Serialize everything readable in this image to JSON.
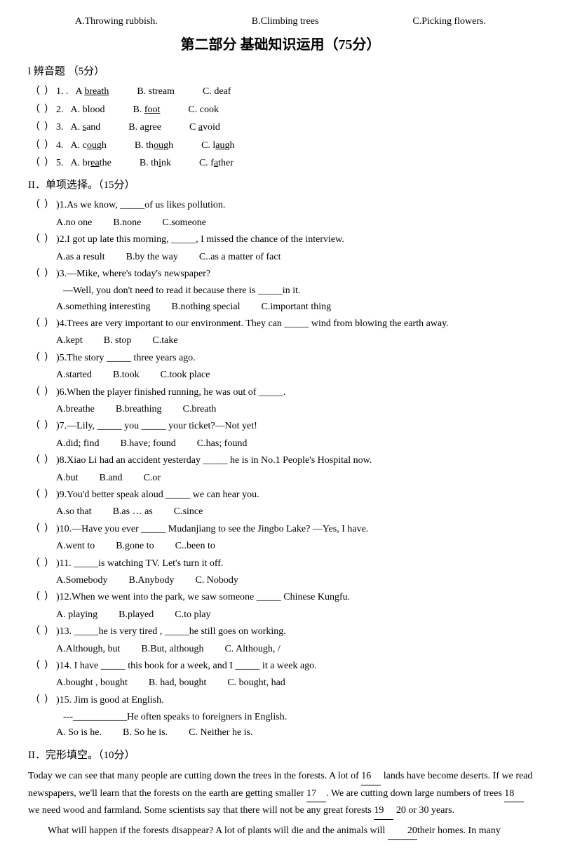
{
  "header": {
    "options": [
      "A.Throwing rubbish.",
      "B.Climbing trees",
      "C.Picking flowers."
    ]
  },
  "part2_title": "第二部分  基础知识运用（75分）",
  "section1": {
    "title": "l 辨音题  （5分）",
    "questions": [
      {
        "num": "1.",
        "label": "A",
        "options": [
          "A. breath",
          "B. stream",
          "C. deaf"
        ]
      },
      {
        "num": "2.",
        "label": "A",
        "options": [
          "A. blood",
          "B. foot",
          "C. cook"
        ]
      },
      {
        "num": "3.",
        "label": "A",
        "options": [
          "A. sand",
          "B. agree",
          "C avoid"
        ]
      },
      {
        "num": "4.",
        "label": "A",
        "options": [
          "A. cough",
          "B. though",
          "C. laugh"
        ]
      },
      {
        "num": "5.",
        "label": "A",
        "options": [
          "A. breathe",
          "B. think",
          "C. father"
        ]
      }
    ]
  },
  "section2": {
    "title": "II．单项选择。（15分）",
    "questions": [
      {
        "num": "1.",
        "text": "As we know, _____of us likes pollution.",
        "options": [
          "A.no one",
          "B.none",
          "C.someone"
        ]
      },
      {
        "num": "2.",
        "text": "I got up late this morning, _____, I missed the chance of the interview.",
        "options": [
          "A.as a result",
          "B.by the way",
          "C..as a matter of fact"
        ]
      },
      {
        "num": "3.",
        "text": "—Mike, where's today's newspaper?\n—Well, you don't need to read it because there is _____in it.",
        "options": [
          "A.something interesting",
          "B.nothing special",
          "C.important thing"
        ]
      },
      {
        "num": "4.",
        "text": "Trees are very important to our environment. They can _____ wind from blowing the earth away.",
        "options": [
          "A.kept",
          "B.   stop",
          "C.take"
        ]
      },
      {
        "num": "5.",
        "text": "The story _____ three years ago.",
        "options": [
          "A.started",
          "B.took",
          "C.took place"
        ]
      },
      {
        "num": "6.",
        "text": "When the player finished running, he was out of _____.",
        "options": [
          "A.breathe",
          "B.breathing",
          "C.breath"
        ]
      },
      {
        "num": "7.",
        "text": "—Lily, _____ you _____ your ticket?—Not yet!",
        "options": [
          "A.did; find",
          "B.have; found",
          "C.has; found"
        ]
      },
      {
        "num": "8.",
        "text": "Xiao Li had an accident yesterday _____ he is in No.1 People's Hospital now.",
        "options": [
          "A.but",
          "B.and",
          "C.or"
        ]
      },
      {
        "num": "9.",
        "text": "You'd better speak aloud _____ we can hear you.",
        "options": [
          "A.so that",
          "B.as … as",
          "C.since"
        ]
      },
      {
        "num": "10.",
        "text": "—Have you ever _____ Mudanjiang to see the Jingbo Lake?  —Yes, I have.",
        "options": [
          "A.went to",
          "B.gone to",
          "C..been to"
        ]
      },
      {
        "num": "11.",
        "text": "_____is watching TV. Let's turn it off.",
        "options": [
          "A.Somebody",
          "B.Anybody",
          "C. Nobody"
        ]
      },
      {
        "num": "12.",
        "text": "When we went into the park, we saw someone _____ Chinese Kungfu.",
        "options": [
          "A. playing",
          "B.played",
          "C.to play"
        ]
      },
      {
        "num": "13.",
        "text": "_____he is very tired , _____he still goes on working.",
        "options": [
          "A.Although, but",
          "B.But, although",
          "C. Although, /"
        ]
      },
      {
        "num": "14.",
        "text": "I have _____ this book for a week, and  I _____ it a week ago.",
        "options": [
          "A.bought , bought",
          "B.  had, bought",
          "C. bought, had"
        ]
      },
      {
        "num": "15.",
        "text": "Jim is good at English.",
        "subtext": "---___________He often speaks to foreigners in English.",
        "options": [
          "A.  So is he.",
          "B.  So he is.",
          "C.  Neither he is."
        ]
      }
    ]
  },
  "section3": {
    "title": "II．完形填空。（10分）",
    "paragraphs": [
      "Today we can see that many people are cutting down the trees in the forests. A lot of __16__ lands have become deserts. If we read newspapers, we'll learn that the forests on the earth are getting smaller __17__. We are cutting down large numbers of trees __18__ we need wood and farmland. Some scientists say that there will not be any great forests __19__ 20 or 30 years.",
      "What will happen if the forests disappear? A lot of plants will die and the animals will __20__their homes. In many"
    ],
    "blanks": [
      "16",
      "17",
      "18",
      "19",
      "20"
    ]
  }
}
